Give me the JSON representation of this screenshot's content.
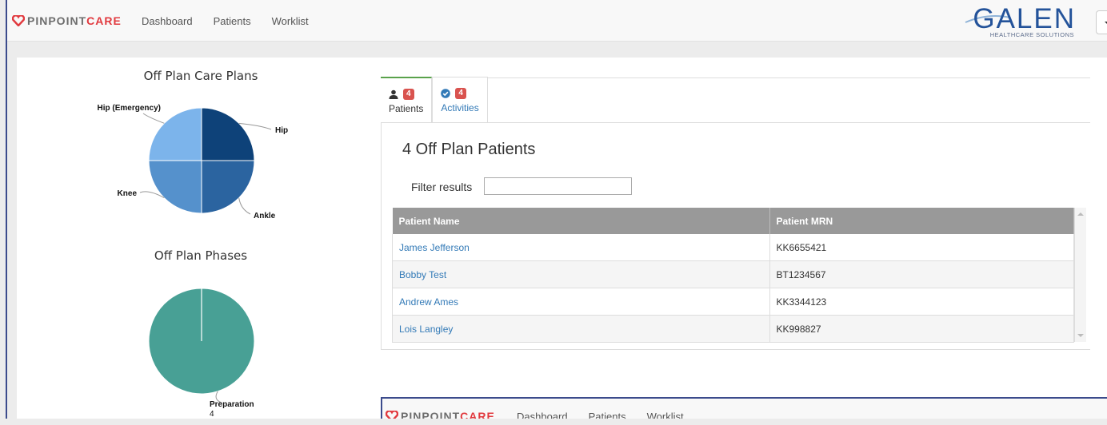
{
  "navbar": {
    "brand_prefix": "PINPOINT",
    "brand_suffix": "CARE",
    "links": [
      "Dashboard",
      "Patients",
      "Worklist"
    ],
    "partner_logo_title": "GALEN",
    "partner_logo_subtitle": "HEALTHCARE SOLUTIONS"
  },
  "charts": {
    "care_plans_title": "Off Plan Care Plans",
    "phases_title": "Off Plan Phases"
  },
  "chart_data": [
    {
      "type": "pie",
      "title": "Off Plan Care Plans",
      "categories": [
        "Hip",
        "Ankle",
        "Knee",
        "Hip (Emergency)"
      ],
      "values": [
        1,
        1,
        1,
        1
      ],
      "colors": [
        "#0e4279",
        "#2b64a0",
        "#5591cc",
        "#7cb4eb"
      ]
    },
    {
      "type": "pie",
      "title": "Off Plan Phases",
      "categories": [
        "Preparation"
      ],
      "values": [
        4
      ],
      "colors": [
        "#48a095"
      ]
    }
  ],
  "tabs": [
    {
      "label": "Patients",
      "count": "4",
      "icon": "user-icon",
      "active": true
    },
    {
      "label": "Activities",
      "count": "4",
      "icon": "check-circle-icon",
      "active": false
    }
  ],
  "panel": {
    "heading": "4 Off Plan Patients",
    "filter_label": "Filter results",
    "filter_value": ""
  },
  "table": {
    "columns": [
      "Patient Name",
      "Patient MRN"
    ],
    "rows": [
      {
        "name": "James Jefferson",
        "mrn": "KK6655421"
      },
      {
        "name": "Bobby Test",
        "mrn": "BT1234567"
      },
      {
        "name": "Andrew Ames",
        "mrn": "KK3344123"
      },
      {
        "name": "Lois Langley",
        "mrn": "KK998827"
      }
    ]
  },
  "colors": {
    "brand_red": "#e1393e",
    "link_blue": "#337ab7",
    "badge_red": "#d9534f",
    "active_tab_green": "#59a24b",
    "table_header": "#999999"
  }
}
